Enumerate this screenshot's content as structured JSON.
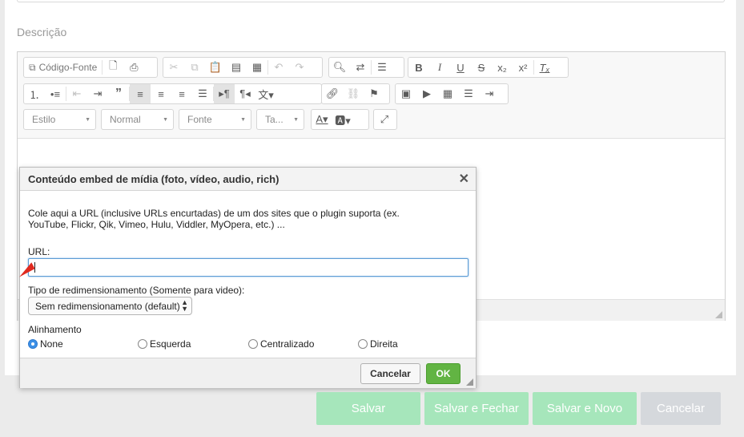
{
  "form": {
    "description_label": "Descrição"
  },
  "toolbar": {
    "source_label": "Código-Fonte",
    "style_combo": "Estilo",
    "format_combo": "Normal",
    "font_combo": "Fonte",
    "size_combo": "Ta..."
  },
  "dialog": {
    "title": "Conteúdo embed de mídia (foto, vídeo, audio, rich)",
    "close_glyph": "✕",
    "description_line1": "Cole aqui a URL (inclusive URLs encurtadas) de um dos sites que o plugin suporta (ex.",
    "description_line2": "YouTube, Flickr, Qik, Vimeo, Hulu, Viddler, MyOpera, etc.) ...",
    "url_label": "URL:",
    "url_value": "",
    "resize_label": "Tipo de redimensionamento (Somente para video):",
    "resize_selected": "Sem redimensionamento (default)",
    "alignment_label": "Alinhamento",
    "alignment_options": [
      "None",
      "Esquerda",
      "Centralizado",
      "Direita"
    ],
    "alignment_selected": "None",
    "cancel_label": "Cancelar",
    "ok_label": "OK"
  },
  "actions": {
    "save": "Salvar",
    "save_close": "Salvar e Fechar",
    "save_new": "Salvar e Novo",
    "cancel": "Cancelar"
  },
  "colors": {
    "save_buttons": "#a6e6bb",
    "cancel_button": "#d5d8dc",
    "ok_button": "#62b443",
    "annotation_arrow": "#e02a1f"
  },
  "icons": [
    "source-icon",
    "new-page-icon",
    "print-icon",
    "cut-icon",
    "copy-icon",
    "paste-icon",
    "paste-text-icon",
    "paste-word-icon",
    "undo-icon",
    "redo-icon",
    "find-icon",
    "replace-icon",
    "spellcheck-icon",
    "bold-icon",
    "italic-icon",
    "underline-icon",
    "strike-icon",
    "subscript-icon",
    "superscript-icon",
    "remove-format-icon",
    "numbered-list-icon",
    "bulleted-list-icon",
    "outdent-icon",
    "indent-icon",
    "blockquote-icon",
    "align-left-icon",
    "align-center-icon",
    "align-right-icon",
    "justify-icon",
    "ltr-icon",
    "rtl-icon",
    "language-icon",
    "link-icon",
    "unlink-icon",
    "anchor-icon",
    "image-icon",
    "media-embed-icon",
    "table-icon",
    "horizontal-rule-icon",
    "page-break-icon",
    "text-color-icon",
    "bg-color-icon",
    "maximize-icon"
  ]
}
